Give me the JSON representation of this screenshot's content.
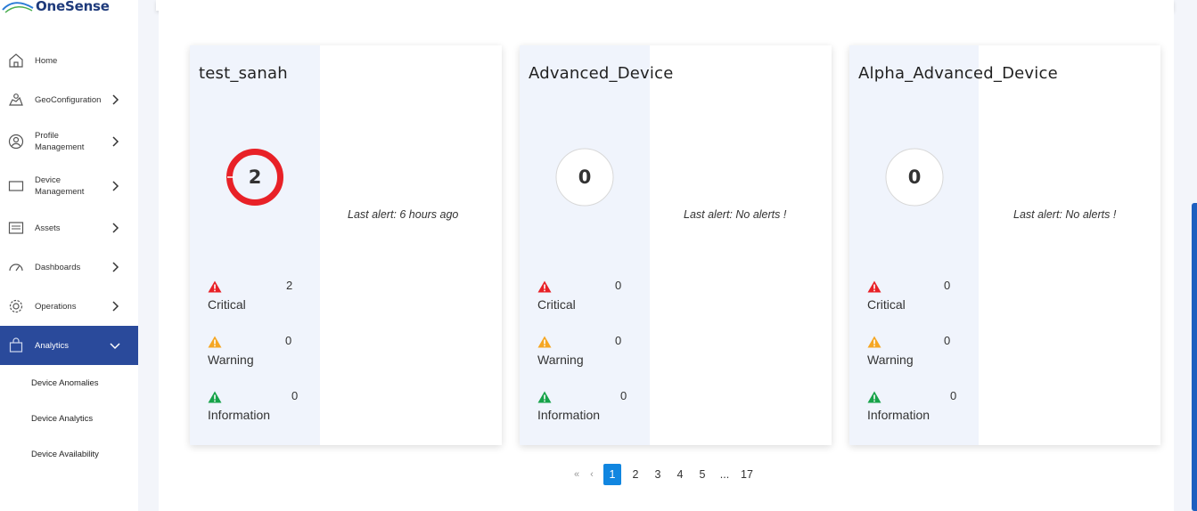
{
  "brand": {
    "logo_text": "OneSense"
  },
  "sidebar": {
    "items": [
      {
        "label": "Home",
        "icon": "home-icon"
      },
      {
        "label": "GeoConfiguration",
        "icon": "map-icon"
      },
      {
        "label": "Profile Management",
        "icon": "user-icon"
      },
      {
        "label": "Device Management",
        "icon": "monitor-icon"
      },
      {
        "label": "Assets",
        "icon": "assets-icon"
      },
      {
        "label": "Dashboards",
        "icon": "dashboard-icon"
      },
      {
        "label": "Operations",
        "icon": "gear-icon"
      },
      {
        "label": "Analytics",
        "icon": "bag-icon"
      }
    ],
    "analytics_sub": [
      "Device Anomalies",
      "Device Analytics",
      "Device Availability"
    ]
  },
  "cards": [
    {
      "title": "test_sanah",
      "total": "2",
      "last_alert": "Last alert: 6 hours ago",
      "critical": "2",
      "warning": "0",
      "information": "0"
    },
    {
      "title": "Advanced_Device",
      "total": "0",
      "last_alert": "Last alert: No alerts !",
      "critical": "0",
      "warning": "0",
      "information": "0"
    },
    {
      "title": "Alpha_Advanced_Device",
      "total": "0",
      "last_alert": "Last alert: No alerts !",
      "critical": "0",
      "warning": "0",
      "information": "0"
    }
  ],
  "severity_labels": {
    "critical": "Critical",
    "warning": "Warning",
    "information": "Information"
  },
  "colors": {
    "critical": "#e82127",
    "warning": "#f5a623",
    "information": "#17a34a",
    "accent": "#2a4a9b",
    "page_active": "#1186e0"
  },
  "pagination": {
    "first": "«",
    "prev": "‹",
    "pages": [
      "1",
      "2",
      "3",
      "4",
      "5"
    ],
    "ellipsis": "...",
    "last_page": "17",
    "next": "›",
    "last": "»",
    "current": "1"
  }
}
